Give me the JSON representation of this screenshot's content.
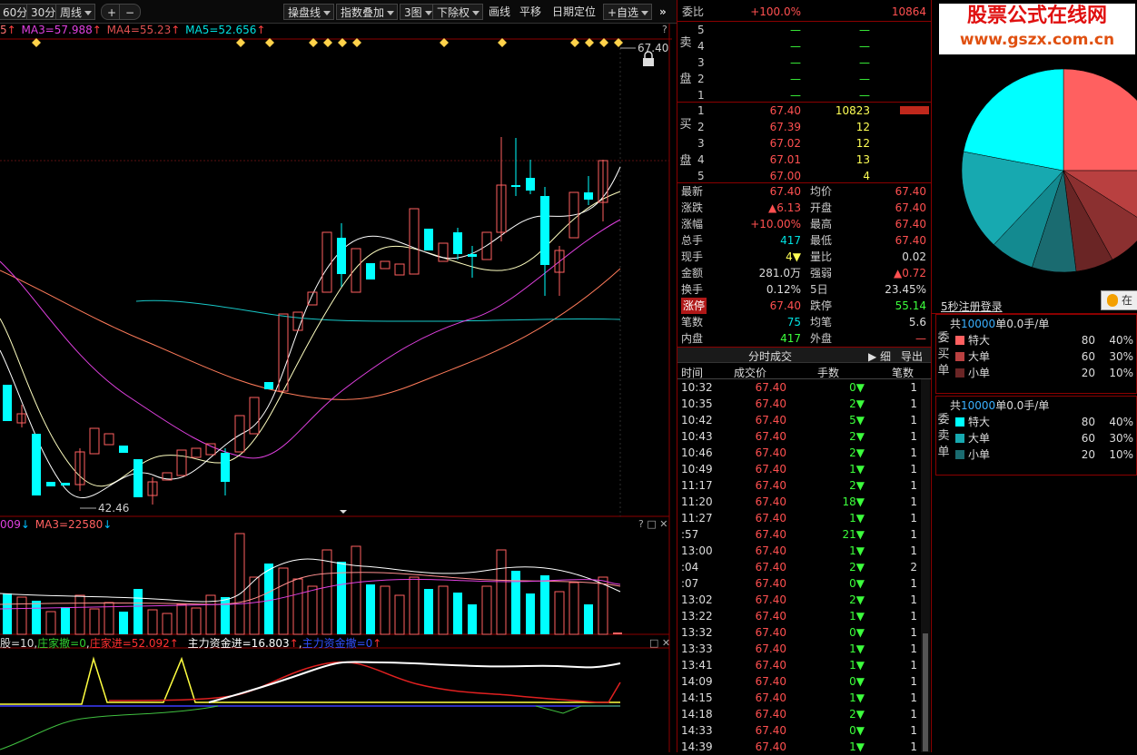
{
  "toolbar": {
    "period_1": "60分",
    "period_2": "30分",
    "period_3": "周线",
    "btn_add": "+",
    "btn_minus": "−",
    "tool_1": "操盘线",
    "tool_2": "指数叠加",
    "tool_3": "3图",
    "tool_4": "下除权",
    "tool_5": "画线",
    "tool_6": "平移",
    "tool_7": "日期定位",
    "tool_8": "+自选",
    "more": "»"
  },
  "kline": {
    "ma_prefix": "5",
    "ma3": "MA3=57.988",
    "ma4": "MA4=55.23",
    "ma5": "MA5=52.656",
    "price_high": "67.40",
    "price_low": "42.46",
    "help": "?"
  },
  "volume": {
    "ma_prefix": "009",
    "ma3": "MA3=22580",
    "help": "?"
  },
  "fund": {
    "t1": "股=10",
    "t2": "庄家撤=0",
    "t3": "庄家进=52.092",
    "t4": "主力资金进=16.803",
    "t5": "主力资金撤=0"
  },
  "quote": {
    "weibi_label": "委比",
    "weibi_val": "+100.0%",
    "weibi_num": "10864",
    "sell_label": [
      "卖",
      "盘"
    ],
    "sell": [
      {
        "n": "5",
        "p": "—",
        "v": "—"
      },
      {
        "n": "4",
        "p": "—",
        "v": "—"
      },
      {
        "n": "3",
        "p": "—",
        "v": "—"
      },
      {
        "n": "2",
        "p": "—",
        "v": "—"
      },
      {
        "n": "1",
        "p": "—",
        "v": "—"
      }
    ],
    "buy_label": [
      "买",
      "盘"
    ],
    "buy": [
      {
        "n": "1",
        "p": "67.40",
        "v": "10823"
      },
      {
        "n": "2",
        "p": "67.39",
        "v": "12"
      },
      {
        "n": "3",
        "p": "67.02",
        "v": "12"
      },
      {
        "n": "4",
        "p": "67.01",
        "v": "13"
      },
      {
        "n": "5",
        "p": "67.00",
        "v": "4"
      }
    ],
    "stats": [
      {
        "l1": "最新",
        "v1": "67.40",
        "c1": "red",
        "l2": "均价",
        "v2": "67.40",
        "c2": "red"
      },
      {
        "l1": "涨跌",
        "v1": "▲6.13",
        "c1": "red",
        "l2": "开盘",
        "v2": "67.40",
        "c2": "red"
      },
      {
        "l1": "涨幅",
        "v1": "+10.00%",
        "c1": "red",
        "l2": "最高",
        "v2": "67.40",
        "c2": "red"
      },
      {
        "l1": "总手",
        "v1": "417",
        "c1": "cyan",
        "l2": "最低",
        "v2": "67.40",
        "c2": "red"
      },
      {
        "l1": "现手",
        "v1": "4▼",
        "c1": "yel",
        "l2": "量比",
        "v2": "0.02",
        "c2": "wht"
      },
      {
        "l1": "金额",
        "v1": "281.0万",
        "c1": "wht",
        "l2": "强弱",
        "v2": "▲0.72",
        "c2": "red"
      },
      {
        "l1": "换手",
        "v1": "0.12%",
        "c1": "wht",
        "l2": "5日",
        "v2": "23.45%",
        "c2": "wht"
      },
      {
        "l1": "涨停",
        "v1": "67.40",
        "c1": "red",
        "l2": "跌停",
        "v2": "55.14",
        "c2": "grn"
      },
      {
        "l1": "笔数",
        "v1": "75",
        "c1": "cyan",
        "l2": "均笔",
        "v2": "5.6",
        "c2": "wht"
      },
      {
        "l1": "内盘",
        "v1": "417",
        "c1": "grn",
        "l2": "外盘",
        "v2": "—",
        "c2": "red"
      }
    ],
    "ticks_title": "分时成交",
    "ticks_detail": "细",
    "ticks_export": "导出",
    "ticks_headers": [
      "时间",
      "成交价",
      "手数",
      "笔数"
    ],
    "ticks": [
      [
        "10:32",
        "67.40",
        "0▼",
        "1"
      ],
      [
        "10:35",
        "67.40",
        "2▼",
        "1"
      ],
      [
        "10:42",
        "67.40",
        "5▼",
        "1"
      ],
      [
        "10:43",
        "67.40",
        "2▼",
        "1"
      ],
      [
        "10:46",
        "67.40",
        "2▼",
        "1"
      ],
      [
        "10:49",
        "67.40",
        "1▼",
        "1"
      ],
      [
        "11:17",
        "67.40",
        "2▼",
        "1"
      ],
      [
        "11:20",
        "67.40",
        "18▼",
        "1"
      ],
      [
        "11:27",
        "67.40",
        "1▼",
        "1"
      ],
      [
        ":57",
        "67.40",
        "21▼",
        "1"
      ],
      [
        "13:00",
        "67.40",
        "1▼",
        "1"
      ],
      [
        ":04",
        "67.40",
        "2▼",
        "2"
      ],
      [
        ":07",
        "67.40",
        "0▼",
        "1"
      ],
      [
        "13:02",
        "67.40",
        "2▼",
        "1"
      ],
      [
        "13:22",
        "67.40",
        "1▼",
        "1"
      ],
      [
        "13:32",
        "67.40",
        "0▼",
        "1"
      ],
      [
        "13:33",
        "67.40",
        "1▼",
        "1"
      ],
      [
        "13:41",
        "67.40",
        "1▼",
        "1"
      ],
      [
        "14:09",
        "67.40",
        "0▼",
        "1"
      ],
      [
        "14:15",
        "67.40",
        "1▼",
        "1"
      ],
      [
        "14:18",
        "67.40",
        "2▼",
        "1"
      ],
      [
        "14:33",
        "67.40",
        "0▼",
        "1"
      ],
      [
        "14:39",
        "67.40",
        "1▼",
        "1"
      ]
    ]
  },
  "side": {
    "banner1": "股票公式在线网",
    "banner2": "www.gszx.com.cn",
    "register": "5秒注册登录",
    "search_btn": "在",
    "pie_shares": [
      {
        "color": "#ff6060",
        "value": 0.25
      },
      {
        "color": "#b94040",
        "value": 0.09
      },
      {
        "color": "#8b3030",
        "value": 0.08
      },
      {
        "color": "#6a2525",
        "value": 0.06
      },
      {
        "color": "#1a6b70",
        "value": 0.07
      },
      {
        "color": "#138a90",
        "value": 0.07
      },
      {
        "color": "#17a9b0",
        "value": 0.16
      },
      {
        "color": "#00ffff",
        "value": 0.22
      }
    ],
    "buy_block": {
      "title_a": "共",
      "title_b": "10000",
      "title_c": "单0.0手/单",
      "side_label": [
        "委",
        "买",
        "单"
      ],
      "rows": [
        {
          "name": "特大",
          "n": "80",
          "p": "40%",
          "color": "#ff6060"
        },
        {
          "name": "大单",
          "n": "60",
          "p": "30%",
          "color": "#b94040"
        },
        {
          "name": "小单",
          "n": "20",
          "p": "10%",
          "color": "#6a2525"
        }
      ]
    },
    "sell_block": {
      "title_a": "共",
      "title_b": "10000",
      "title_c": "单0.0手/单",
      "side_label": [
        "委",
        "卖",
        "单"
      ],
      "rows": [
        {
          "name": "特大",
          "n": "80",
          "p": "40%",
          "color": "#00ffff"
        },
        {
          "name": "大单",
          "n": "60",
          "p": "30%",
          "color": "#17a9b0"
        },
        {
          "name": "小单",
          "n": "20",
          "p": "10%",
          "color": "#1a6b70"
        }
      ]
    }
  }
}
